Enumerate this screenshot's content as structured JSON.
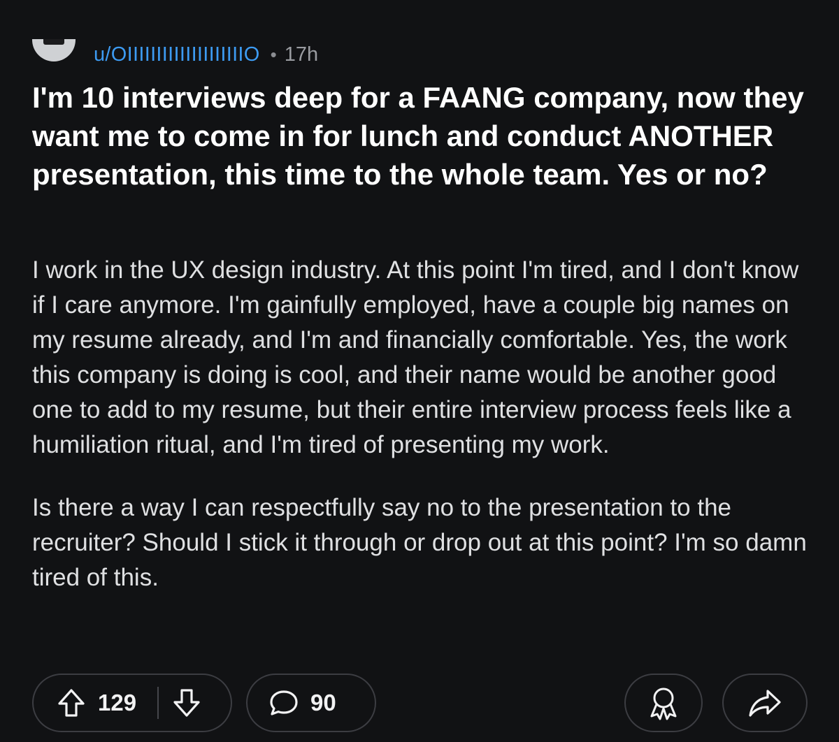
{
  "post": {
    "author": "u/OIIIIIIIIIIIIIIIIIIIIO",
    "separator": "•",
    "age": "17h",
    "title": "I'm 10 interviews deep for a FAANG company, now they want me to come in for lunch and conduct ANOTHER presentation, this time to the whole team. Yes or no?",
    "body": [
      "I work in the UX design industry. At this point I'm tired, and I don't know if I care anymore. I'm gainfully employed, have a couple big names on my resume already, and I'm and financially comfortable. Yes, the work this company is doing is cool, and their name would be another good one to add to my resume, but their entire interview process feels like a humiliation ritual, and I'm tired of presenting my work.",
      "Is there a way I can respectfully say no to the presentation to the recruiter? Should I stick it through or drop out at this point? I'm so damn tired of this."
    ]
  },
  "actions": {
    "upvote_icon": "arrow-up-icon",
    "score": "129",
    "downvote_icon": "arrow-down-icon",
    "comment_icon": "speech-bubble-icon",
    "comment_count": "90",
    "award_icon": "award-ribbon-icon",
    "share_icon": "share-arrow-icon"
  },
  "colors": {
    "background": "#111214",
    "username": "#3d9bf2",
    "text": "#ffffff",
    "pill_border": "#3c3d42"
  }
}
